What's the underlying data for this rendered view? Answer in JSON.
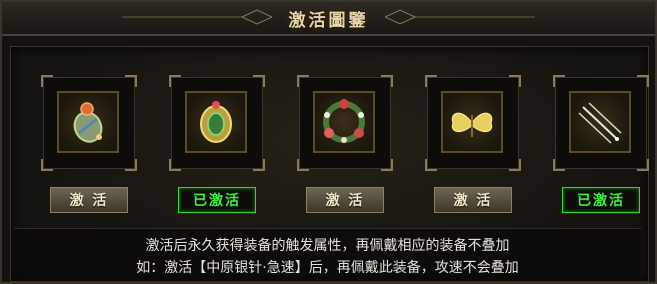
{
  "window": {
    "title": "激活圖鑒"
  },
  "slots": [
    {
      "icon": "amulet-icon",
      "button": "激 活",
      "activated": false
    },
    {
      "icon": "jade-bracelet-icon",
      "button": "已激活",
      "activated": true
    },
    {
      "icon": "flower-wreath-icon",
      "button": "激 活",
      "activated": false
    },
    {
      "icon": "golden-butterfly-icon",
      "button": "激 活",
      "activated": false
    },
    {
      "icon": "silver-needles-icon",
      "button": "已激活",
      "activated": true
    }
  ],
  "description": {
    "line1": "激活后永久获得装备的触发属性，再佩戴相应的装备不叠加",
    "line2": "如：激活【中原银针·急速】后，再佩戴此装备，攻速不会叠加"
  },
  "colors": {
    "activate_text": "#f3e8c8",
    "activated_text": "#3ff03f",
    "title": "#e8d7a8"
  }
}
